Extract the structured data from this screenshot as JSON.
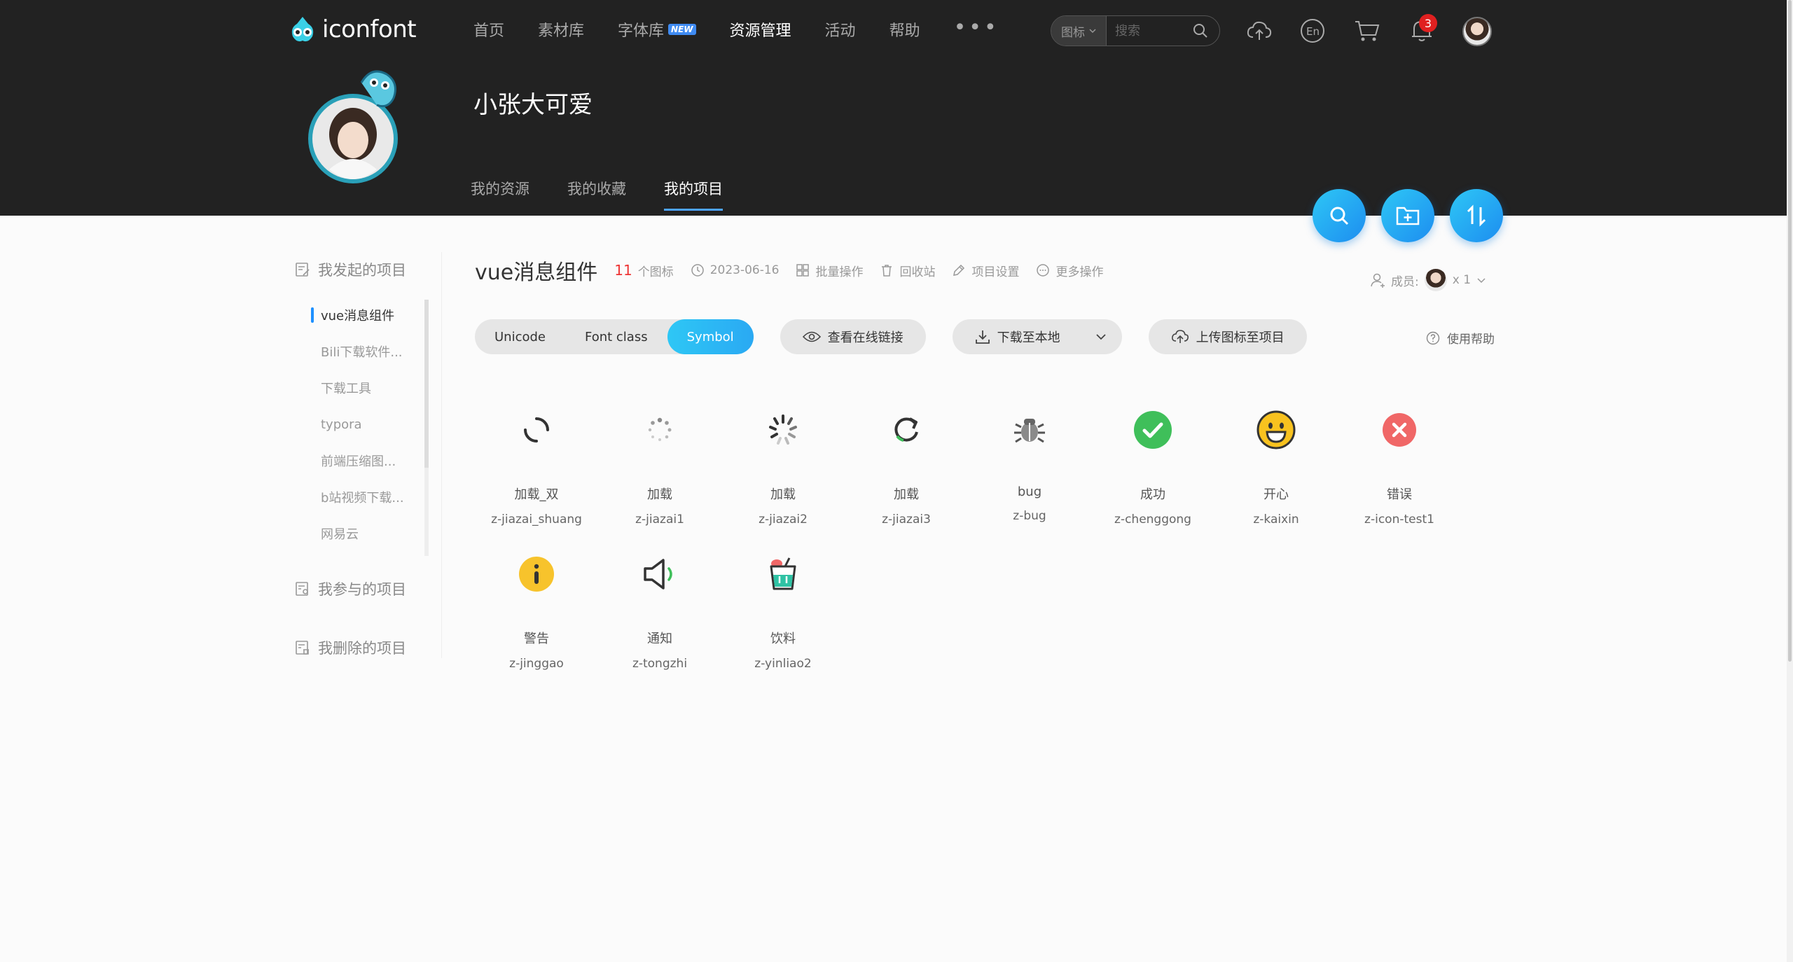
{
  "brand": {
    "name": "iconfont"
  },
  "nav": {
    "items": [
      {
        "label": "首页"
      },
      {
        "label": "素材库"
      },
      {
        "label": "字体库"
      },
      {
        "label": "资源管理"
      },
      {
        "label": "活动"
      },
      {
        "label": "帮助"
      }
    ],
    "new_badge": "NEW",
    "more": "•••"
  },
  "search": {
    "type": "图标",
    "placeholder": "搜索"
  },
  "notifications": {
    "count": "3"
  },
  "profile": {
    "username": "小张大可爱",
    "tabs": [
      {
        "label": "我的资源"
      },
      {
        "label": "我的收藏"
      },
      {
        "label": "我的项目"
      }
    ]
  },
  "sidebar": {
    "created_heading": "我发起的项目",
    "projects": [
      {
        "label": "vue消息组件"
      },
      {
        "label": "Bili下载软件..."
      },
      {
        "label": "下载工具"
      },
      {
        "label": "typora"
      },
      {
        "label": "前端压缩图..."
      },
      {
        "label": "b站视频下载..."
      },
      {
        "label": "网易云"
      }
    ],
    "joined_heading": "我参与的项目",
    "deleted_heading": "我删除的项目"
  },
  "project": {
    "title": "vue消息组件",
    "count": "11",
    "count_unit": "个图标",
    "date": "2023-06-16",
    "batch": "批量操作",
    "recycle": "回收站",
    "settings": "项目设置",
    "more": "更多操作",
    "members_label": "成员:",
    "members_count": "x 1"
  },
  "toolbar": {
    "modes": [
      {
        "label": "Unicode"
      },
      {
        "label": "Font class"
      },
      {
        "label": "Symbol"
      }
    ],
    "view_link": "查看在线链接",
    "download": "下载至本地",
    "upload": "上传图标至项目",
    "help": "使用帮助"
  },
  "icons": [
    {
      "name": "加载_双",
      "code": "z-jiazai_shuang",
      "glyph": "spinner-double-icon"
    },
    {
      "name": "加载",
      "code": "z-jiazai1",
      "glyph": "spinner-dots-icon"
    },
    {
      "name": "加载",
      "code": "z-jiazai2",
      "glyph": "spinner-lines-icon"
    },
    {
      "name": "加载",
      "code": "z-jiazai3",
      "glyph": "refresh-icon"
    },
    {
      "name": "bug",
      "code": "z-bug",
      "glyph": "bug-icon"
    },
    {
      "name": "成功",
      "code": "z-chenggong",
      "glyph": "success-icon"
    },
    {
      "name": "开心",
      "code": "z-kaixin",
      "glyph": "smile-icon"
    },
    {
      "name": "错误",
      "code": "z-icon-test1",
      "glyph": "error-icon"
    },
    {
      "name": "警告",
      "code": "z-jinggao",
      "glyph": "warning-icon"
    },
    {
      "name": "通知",
      "code": "z-tongzhi",
      "glyph": "speaker-icon"
    },
    {
      "name": "饮料",
      "code": "z-yinliao2",
      "glyph": "drink-icon"
    }
  ],
  "colors": {
    "accent": "#1e90ff",
    "success": "#3fbf5a",
    "error": "#f06767",
    "warning": "#f7c32c",
    "header_bg": "#222222"
  }
}
